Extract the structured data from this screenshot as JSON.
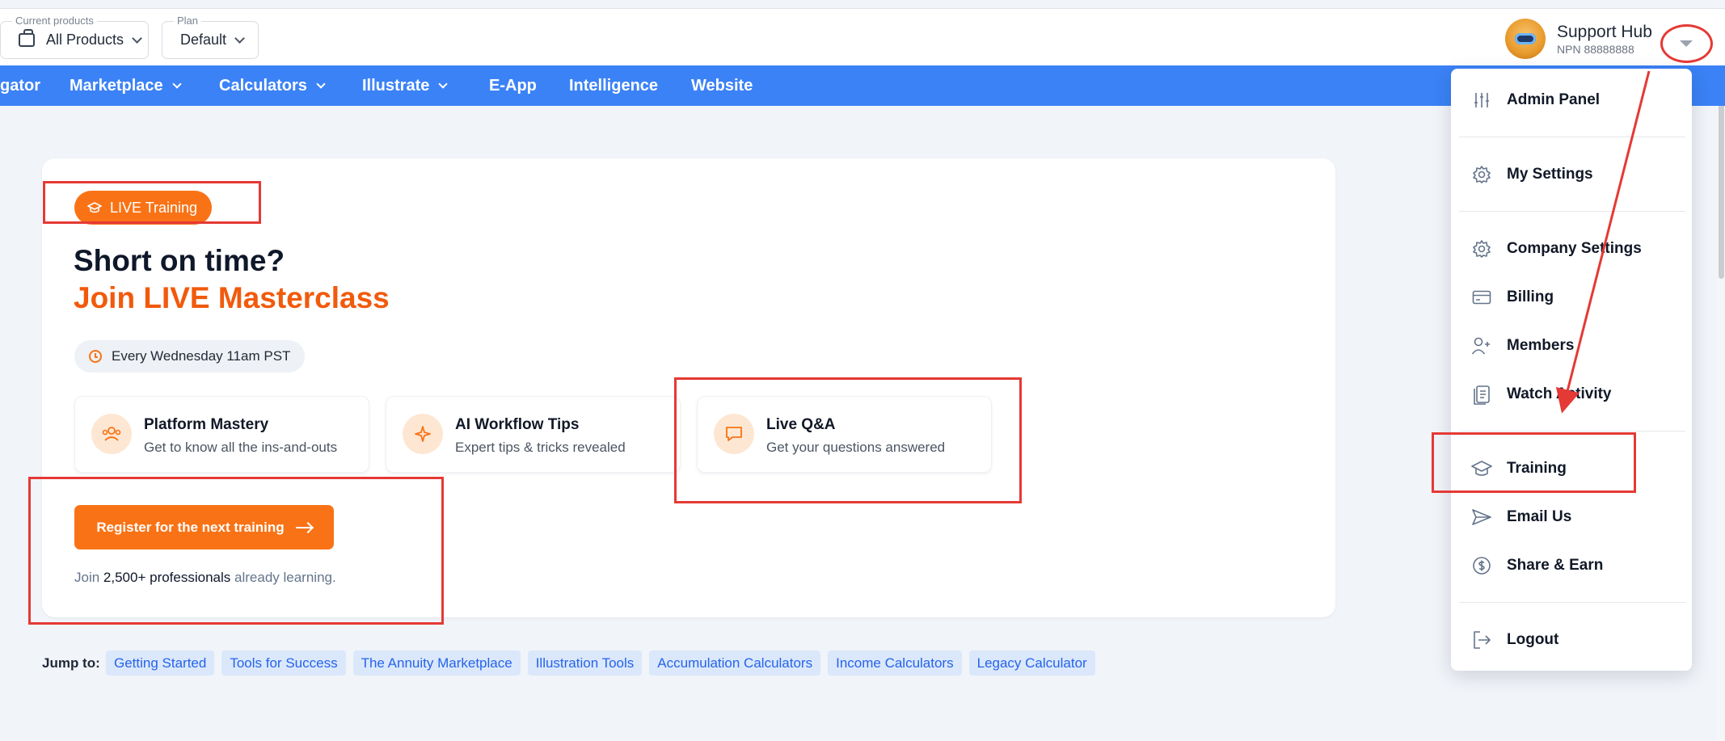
{
  "topbar": {
    "products": {
      "caption": "Current products",
      "value": "All Products"
    },
    "plan": {
      "caption": "Plan",
      "value": "Default"
    },
    "profile": {
      "name": "Support Hub",
      "npn": "NPN 88888888"
    }
  },
  "nav": [
    {
      "label": "gator",
      "has_chevron": false
    },
    {
      "label": "Marketplace",
      "has_chevron": true
    },
    {
      "label": "Calculators",
      "has_chevron": true
    },
    {
      "label": "Illustrate",
      "has_chevron": true
    },
    {
      "label": "E-App",
      "has_chevron": false
    },
    {
      "label": "Intelligence",
      "has_chevron": false
    },
    {
      "label": "Website",
      "has_chevron": false
    }
  ],
  "hero": {
    "badge": "LIVE Training",
    "heading": "Short on time?",
    "subheading": "Join LIVE Masterclass",
    "schedule": "Every Wednesday 11am PST",
    "features": [
      {
        "title": "Platform Mastery",
        "desc": "Get to know all the ins-and-outs",
        "icon": "users-icon"
      },
      {
        "title": "AI Workflow Tips",
        "desc": "Expert tips & tricks revealed",
        "icon": "sparkles-icon"
      },
      {
        "title": "Live Q&A",
        "desc": "Get your questions answered",
        "icon": "chat-bubble-icon"
      }
    ],
    "cta": "Register for the next training",
    "join_pre": "Join",
    "join_count": "2,500+ professionals",
    "join_post": "already learning."
  },
  "jump": {
    "label": "Jump to:",
    "links": [
      "Getting Started",
      "Tools for Success",
      "The Annuity Marketplace",
      "Illustration Tools",
      "Accumulation Calculators",
      "Income Calculators",
      "Legacy Calculator"
    ]
  },
  "menu": {
    "items": [
      {
        "label": "Admin Panel",
        "icon": "sliders-icon"
      },
      {
        "label": "My Settings",
        "icon": "gear-icon"
      },
      {
        "label": "Company Settings",
        "icon": "gear-icon"
      },
      {
        "label": "Billing",
        "icon": "credit-card-icon"
      },
      {
        "label": "Members",
        "icon": "user-plus-icon"
      },
      {
        "label": "Watch Activity",
        "icon": "clipboard-icon"
      },
      {
        "label": "Training",
        "icon": "graduation-cap-icon"
      },
      {
        "label": "Email Us",
        "icon": "send-icon"
      },
      {
        "label": "Share & Earn",
        "icon": "dollar-circle-icon"
      },
      {
        "label": "Logout",
        "icon": "logout-icon"
      }
    ]
  },
  "colors": {
    "nav_blue": "#3b82f6",
    "accent_orange": "#f97316",
    "heading_orange": "#f15a0c",
    "chip_bg": "#dbe8fb",
    "chip_text": "#2563eb",
    "annotation_red": "#e53935"
  }
}
